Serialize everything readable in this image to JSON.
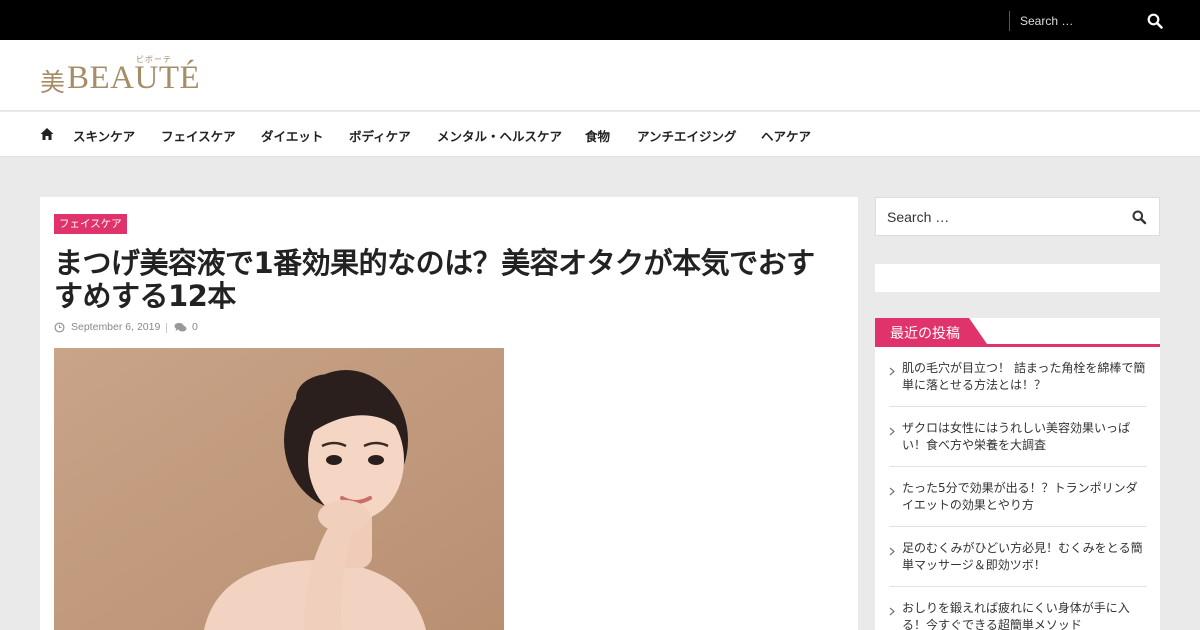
{
  "top_search": {
    "placeholder": "Search …"
  },
  "logo": {
    "kanji": "美",
    "word": "BEAUTÉ",
    "furigana": "ビボーテ"
  },
  "nav": {
    "items": [
      {
        "label": "スキンケア"
      },
      {
        "label": "フェイスケア"
      },
      {
        "label": "ダイエット"
      },
      {
        "label": "ボディケア"
      },
      {
        "label": "メンタル・ヘルスケア"
      },
      {
        "label": "食物"
      },
      {
        "label": "アンチエイジング"
      },
      {
        "label": "ヘアケア"
      }
    ]
  },
  "article": {
    "category": "フェイスケア",
    "title": "まつげ美容液で1番効果的なのは？美容オタクが本気でおすすめする12本",
    "date": "September 6, 2019",
    "comments": "0"
  },
  "sidebar": {
    "search_placeholder": "Search …",
    "recent_title": "最近の投稿",
    "recent_posts": [
      {
        "title": "肌の毛穴が目立つ！ 詰まった角栓を綿棒で簡単に落とせる方法とは！？"
      },
      {
        "title": "ザクロは女性にはうれしい美容効果いっぱい！食べ方や栄養を大調査"
      },
      {
        "title": "たった5分で効果が出る！？トランポリンダイエットの効果とやり方"
      },
      {
        "title": "足のむくみがひどい方必見！むくみをとる簡単マッサージ＆即効ツボ！"
      },
      {
        "title": "おしりを鍛えれば疲れにくい身体が手に入る！今すぐできる超簡単メソッド"
      }
    ]
  },
  "colors": {
    "accent": "#e0336b",
    "logo": "#a58d68",
    "topbar": "#000000",
    "background": "#eaeaea"
  }
}
